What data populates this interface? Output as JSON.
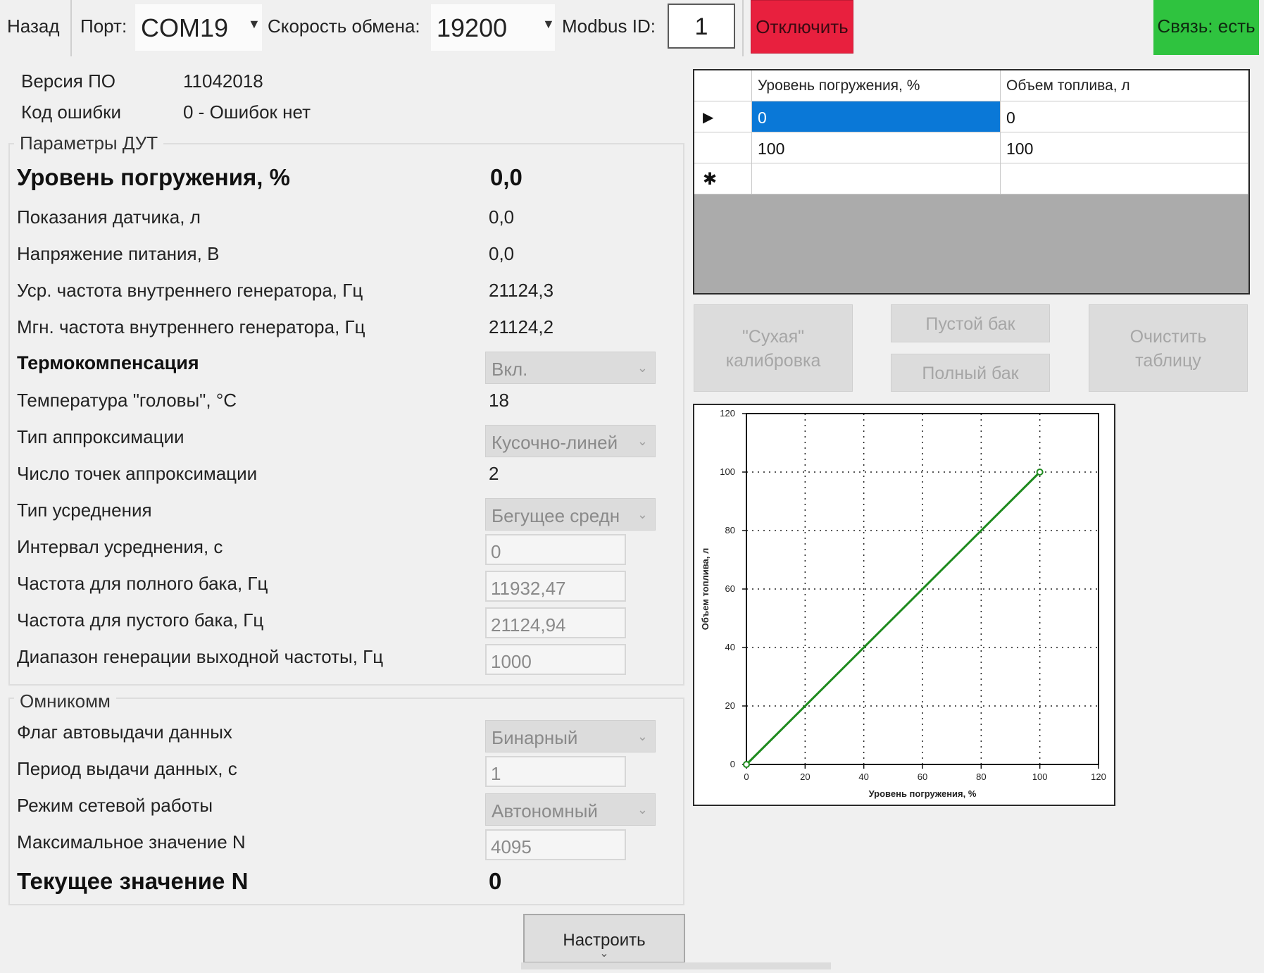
{
  "toolbar": {
    "back_label": "Назад",
    "port_label": "Порт:",
    "port_value": "COM19",
    "baud_label": "Скорость обмена:",
    "baud_value": "19200",
    "modbus_label": "Modbus ID:",
    "modbus_value": "1",
    "disconnect_label": "Отключить",
    "status_label": "Связь: есть",
    "disconnect_color": "#e8203e",
    "status_color": "#2fc33f"
  },
  "info": {
    "firmware_label": "Версия ПО",
    "firmware_value": "11042018",
    "error_label": "Код ошибки",
    "error_value": "0 - Ошибок нет"
  },
  "params": {
    "title": "Параметры ДУТ",
    "rows": [
      {
        "label": "Уровень погружения, %",
        "value": "0,0"
      },
      {
        "label": "Показания датчика, л",
        "value": "0,0"
      },
      {
        "label": "Напряжение питания, В",
        "value": "0,0"
      },
      {
        "label": "Уср. частота внутреннего генератора, Гц",
        "value": "21124,3"
      },
      {
        "label": "Мгн. частота внутреннего генератора, Гц",
        "value": "21124,2"
      },
      {
        "label": "Термокомпенсация",
        "value": "Вкл."
      },
      {
        "label": "Температура \"головы\", °С",
        "value": "18"
      },
      {
        "label": "Тип аппроксимации",
        "value": "Кусочно-линей"
      },
      {
        "label": "Число точек аппроксимации",
        "value": "2"
      },
      {
        "label": "Тип усреднения",
        "value": "Бегущее средн"
      },
      {
        "label": "Интервал усреднения, с",
        "value": "0"
      },
      {
        "label": "Частота для полного бака, Гц",
        "value": "11932,47"
      },
      {
        "label": "Частота для пустого бака, Гц",
        "value": "21124,94"
      },
      {
        "label": "Диапазон генерации выходной частоты, Гц",
        "value": "1000"
      }
    ]
  },
  "omnicomm": {
    "title": "Омникомм",
    "rows": [
      {
        "label": "Флаг автовыдачи данных",
        "value": "Бинарный"
      },
      {
        "label": "Период выдачи данных, с",
        "value": "1"
      },
      {
        "label": "Режим сетевой работы",
        "value": "Автономный"
      },
      {
        "label": "Максимальное значение N",
        "value": "4095"
      },
      {
        "label": "Текущее значение N",
        "value": "0"
      }
    ]
  },
  "setup_button": {
    "label": "Настроить",
    "chevron": "⌄"
  },
  "table": {
    "columns": [
      "Уровень погружения, %",
      "Объем топлива, л"
    ],
    "rows": [
      [
        "0",
        "0"
      ],
      [
        "100",
        "100"
      ]
    ],
    "current_marker": "▶",
    "new_row_marker": "✱"
  },
  "calibration": {
    "dry_line1": "\"Сухая\"",
    "dry_line2": "калибровка",
    "empty_tank": "Пустой бак",
    "full_tank": "Полный бак",
    "clear_line1": "Очистить",
    "clear_line2": "таблицу"
  },
  "chart_data": {
    "type": "line",
    "xlabel": "Уровень погружения, %",
    "ylabel": "Объем топлива, л",
    "xlim": [
      0,
      120
    ],
    "ylim": [
      0,
      120
    ],
    "xticks": [
      "0",
      "20",
      "40",
      "60",
      "80",
      "100",
      "120"
    ],
    "yticks": [
      "0",
      "20",
      "40",
      "60",
      "80",
      "100",
      "120"
    ],
    "grid": true,
    "line_color": "#1e8a1e",
    "series": [
      {
        "x": [
          0,
          100
        ],
        "y": [
          0,
          100
        ]
      }
    ]
  }
}
